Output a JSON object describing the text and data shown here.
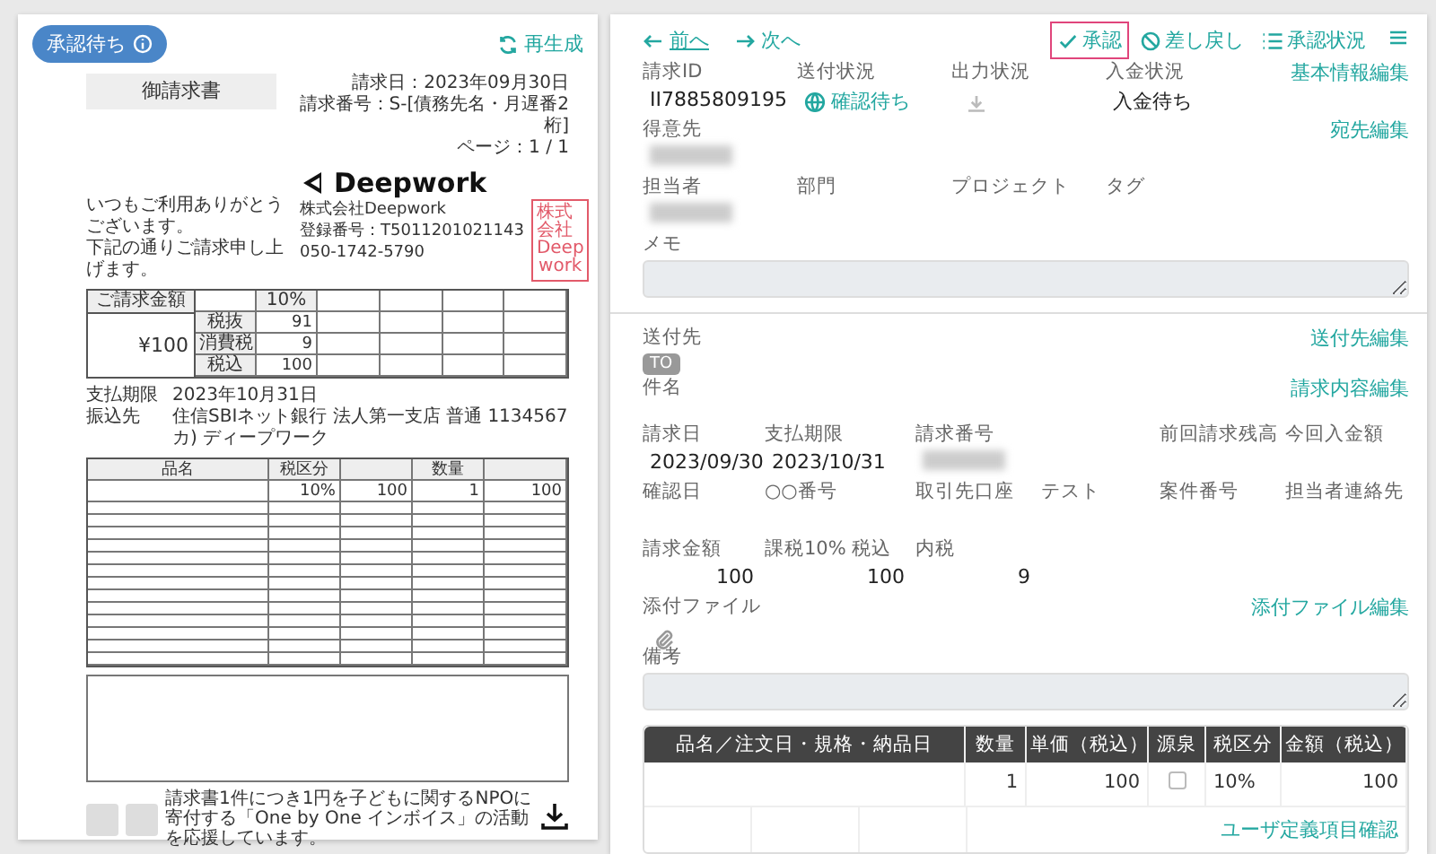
{
  "preview": {
    "status_badge": "承認待ち",
    "regenerate": "再生成",
    "document": {
      "title": "御請求書",
      "meta": [
        "請求日：2023年09月30日",
        "請求番号：S-[債務先名・月遅番2桁]",
        "ページ：1 / 1"
      ],
      "logo": "Deepwork",
      "stamp": [
        "株式会社",
        "Deep",
        "work"
      ],
      "company": [
        "株式会社Deepwork",
        "登録番号：T5011201021143",
        "050-1742-5790"
      ],
      "greeting": [
        "いつもご利用ありがとうございます。",
        "下記の通りご請求申し上げます。"
      ],
      "summary": {
        "label": "ご請求金額",
        "amount": "¥100",
        "rate": "10%",
        "rows": [
          {
            "label": "税抜",
            "value": "91"
          },
          {
            "label": "消費税",
            "value": "9"
          },
          {
            "label": "税込",
            "value": "100"
          }
        ]
      },
      "payment": [
        {
          "label": "支払期限",
          "value": "2023年10月31日"
        },
        {
          "label": "振込先",
          "value": "住信SBIネット銀行 法人第一支店 普通 1134567 カ) ディープワーク"
        }
      ],
      "items": {
        "columns": [
          "品名",
          "税区分",
          "",
          "数量",
          ""
        ],
        "rows": [
          [
            "",
            "10%",
            "100",
            "1",
            "100"
          ]
        ]
      },
      "footer": "請求書1件につき1円を子どもに関するNPOに寄付する「One by One インボイス」の活動を応援しています。"
    }
  },
  "detail": {
    "nav": {
      "prev": "前へ",
      "next": "次へ"
    },
    "actions": [
      {
        "kind": "approve",
        "label": "承認",
        "highlighted": true
      },
      {
        "kind": "return",
        "label": "差し戻し",
        "highlighted": false
      },
      {
        "kind": "status",
        "label": "承認状況",
        "highlighted": false
      }
    ],
    "basic_rows": [
      {
        "edit": "基本情報編集",
        "fields": [
          {
            "label": "請求ID",
            "kind": "text",
            "value": "II7885809195"
          },
          {
            "label": "送付状況",
            "kind": "link",
            "value": "確認待ち"
          },
          {
            "label": "出力状況",
            "kind": "download"
          },
          {
            "label": "入金状況",
            "kind": "text",
            "value": "入金待ち"
          }
        ]
      },
      {
        "edit": "宛先編集",
        "fields": [
          {
            "label": "得意先",
            "kind": "redacted"
          }
        ]
      },
      {
        "fields": [
          {
            "label": "担当者",
            "kind": "redacted"
          },
          {
            "label": "部門",
            "kind": "empty"
          },
          {
            "label": "プロジェクト",
            "kind": "empty"
          },
          {
            "label": "タグ",
            "kind": "empty"
          }
        ]
      }
    ],
    "memo": {
      "label": "メモ"
    },
    "recipient": {
      "label": "送付先",
      "badge": "TO",
      "edit": "送付先編集"
    },
    "subject": {
      "label": "件名",
      "edit": "請求内容編集"
    },
    "grid_rows": [
      [
        {
          "label": "請求日",
          "kind": "text",
          "value": "2023/09/30"
        },
        {
          "label": "支払期限",
          "kind": "text",
          "value": "2023/10/31"
        },
        {
          "label": "請求番号",
          "kind": "redacted"
        },
        {
          "kind": "blank"
        },
        {
          "label": "前回請求残高",
          "kind": "empty"
        },
        {
          "label": "今回入金額",
          "kind": "empty"
        }
      ],
      [
        {
          "label": "確認日",
          "kind": "empty"
        },
        {
          "label": "○○番号",
          "kind": "empty"
        },
        {
          "label": "取引先口座",
          "kind": "empty"
        },
        {
          "label": "テスト",
          "kind": "empty"
        },
        {
          "label": "案件番号",
          "kind": "empty"
        },
        {
          "label": "担当者連絡先",
          "kind": "empty"
        }
      ],
      [
        {
          "label": "請求金額",
          "kind": "amount",
          "value": "100"
        },
        {
          "label": "課税10% 税込",
          "kind": "amount",
          "value": "100"
        },
        {
          "label": "内税",
          "kind": "amount",
          "value": "9"
        }
      ]
    ],
    "attachment": {
      "label": "添付ファイル",
      "edit": "添付ファイル編集"
    },
    "remarks": {
      "label": "備考"
    },
    "lines": {
      "columns": [
        "品名／注文日・規格・納品日",
        "数量",
        "単価（税込）",
        "源泉",
        "税区分",
        "金額（税込）"
      ],
      "rows": [
        {
          "name": "",
          "quantity": "1",
          "unit_price": "100",
          "withholding": false,
          "tax": "10%",
          "amount": "100"
        }
      ],
      "custom_link": "ユーザ定義項目確認"
    }
  }
}
